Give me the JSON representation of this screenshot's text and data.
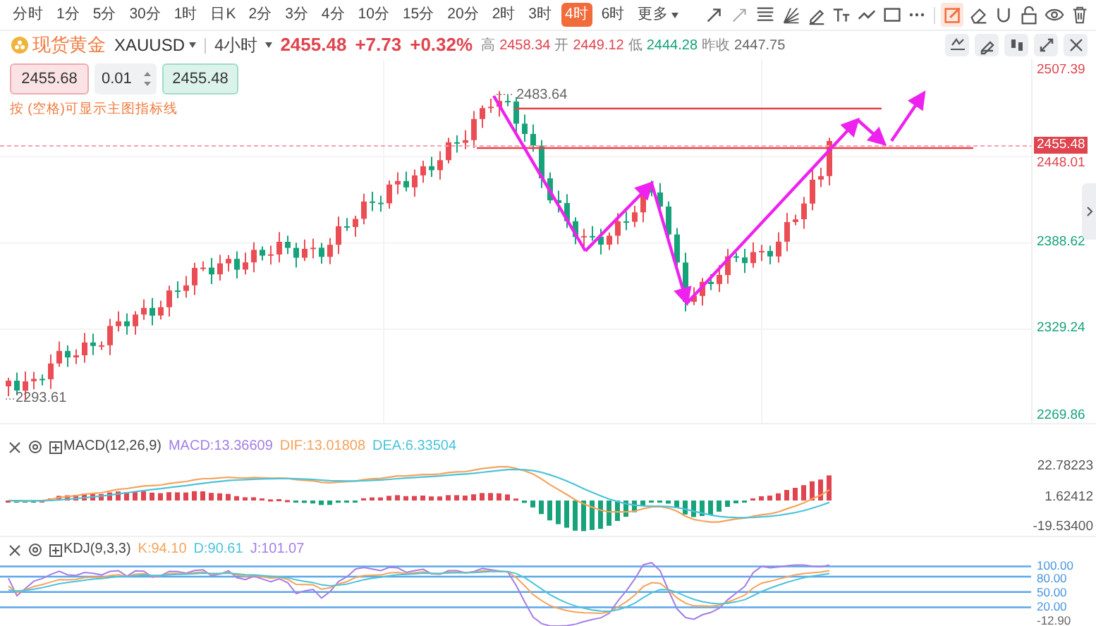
{
  "timeframes": [
    {
      "label": "分时",
      "selected": false
    },
    {
      "label": "1分",
      "selected": false
    },
    {
      "label": "5分",
      "selected": false
    },
    {
      "label": "30分",
      "selected": false
    },
    {
      "label": "1时",
      "selected": false
    },
    {
      "label": "日K",
      "selected": false
    },
    {
      "label": "2分",
      "selected": false
    },
    {
      "label": "3分",
      "selected": false
    },
    {
      "label": "4分",
      "selected": false
    },
    {
      "label": "10分",
      "selected": false
    },
    {
      "label": "15分",
      "selected": false
    },
    {
      "label": "20分",
      "selected": false
    },
    {
      "label": "2时",
      "selected": false
    },
    {
      "label": "3时",
      "selected": false
    },
    {
      "label": "4时",
      "selected": true
    },
    {
      "label": "6时",
      "selected": false
    }
  ],
  "more_menu": {
    "label": "更多"
  },
  "drawing_tools": [
    {
      "kind": "arrow",
      "selected": false
    },
    {
      "kind": "thin-arrow",
      "selected": false
    },
    {
      "kind": "channel",
      "selected": false
    },
    {
      "kind": "fan",
      "selected": false
    },
    {
      "kind": "pen",
      "selected": false
    },
    {
      "kind": "text",
      "selected": false
    },
    {
      "kind": "wave",
      "selected": false
    },
    {
      "kind": "rectangle",
      "selected": false
    },
    {
      "kind": "more",
      "selected": false
    },
    {
      "kind": "edit",
      "selected": true
    },
    {
      "kind": "eraser",
      "selected": false
    },
    {
      "kind": "magnet",
      "selected": false
    },
    {
      "kind": "lock",
      "selected": false
    },
    {
      "kind": "eye",
      "selected": false
    },
    {
      "kind": "trash",
      "selected": false
    }
  ],
  "instrument": {
    "name": "现货黄金",
    "symbol": "XAUUSD",
    "period": "4小时",
    "price": "2455.48",
    "change": "+7.73",
    "change_pct": "+0.32%",
    "high_label": "高",
    "high": "2458.34",
    "open_label": "开",
    "open": "2449.12",
    "low_label": "低",
    "low": "2444.28",
    "prev_close_label": "昨收",
    "prev_close": "2447.75"
  },
  "order_panel": {
    "sell_price": "2455.68",
    "lot": "0.01",
    "buy_price": "2455.48",
    "hint": "按 (空格)可显示主图指标线"
  },
  "price_axis": {
    "labels": [
      "2507.39",
      "2448.01",
      "2388.62",
      "2329.24",
      "2269.86"
    ],
    "current_price": "2455.48"
  },
  "chart_labels": {
    "high_marker": "2483.64",
    "low_marker": "2293.61"
  },
  "macd": {
    "title": "MACD(12,26,9)",
    "macd": "MACD:13.36609",
    "dif": "DIF:13.01808",
    "dea": "DEA:6.33504",
    "axis": [
      "22.78223",
      "1.62412",
      "-19.53400"
    ]
  },
  "kdj": {
    "title": "KDJ(9,3,3)",
    "k": "K:94.10",
    "d": "D:90.61",
    "j": "J:101.07",
    "axis": [
      "100.00",
      "80.00",
      "50.00",
      "20.00",
      "-12.90"
    ]
  }
}
